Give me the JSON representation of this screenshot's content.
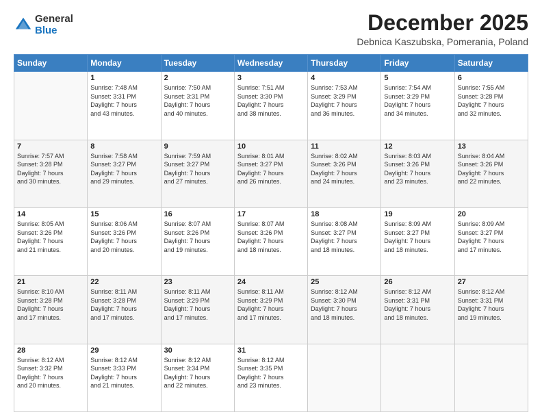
{
  "logo": {
    "general": "General",
    "blue": "Blue"
  },
  "header": {
    "month": "December 2025",
    "location": "Debnica Kaszubska, Pomerania, Poland"
  },
  "weekdays": [
    "Sunday",
    "Monday",
    "Tuesday",
    "Wednesday",
    "Thursday",
    "Friday",
    "Saturday"
  ],
  "weeks": [
    [
      {
        "day": "",
        "info": ""
      },
      {
        "day": "1",
        "info": "Sunrise: 7:48 AM\nSunset: 3:31 PM\nDaylight: 7 hours\nand 43 minutes."
      },
      {
        "day": "2",
        "info": "Sunrise: 7:50 AM\nSunset: 3:31 PM\nDaylight: 7 hours\nand 40 minutes."
      },
      {
        "day": "3",
        "info": "Sunrise: 7:51 AM\nSunset: 3:30 PM\nDaylight: 7 hours\nand 38 minutes."
      },
      {
        "day": "4",
        "info": "Sunrise: 7:53 AM\nSunset: 3:29 PM\nDaylight: 7 hours\nand 36 minutes."
      },
      {
        "day": "5",
        "info": "Sunrise: 7:54 AM\nSunset: 3:29 PM\nDaylight: 7 hours\nand 34 minutes."
      },
      {
        "day": "6",
        "info": "Sunrise: 7:55 AM\nSunset: 3:28 PM\nDaylight: 7 hours\nand 32 minutes."
      }
    ],
    [
      {
        "day": "7",
        "info": "Sunrise: 7:57 AM\nSunset: 3:28 PM\nDaylight: 7 hours\nand 30 minutes."
      },
      {
        "day": "8",
        "info": "Sunrise: 7:58 AM\nSunset: 3:27 PM\nDaylight: 7 hours\nand 29 minutes."
      },
      {
        "day": "9",
        "info": "Sunrise: 7:59 AM\nSunset: 3:27 PM\nDaylight: 7 hours\nand 27 minutes."
      },
      {
        "day": "10",
        "info": "Sunrise: 8:01 AM\nSunset: 3:27 PM\nDaylight: 7 hours\nand 26 minutes."
      },
      {
        "day": "11",
        "info": "Sunrise: 8:02 AM\nSunset: 3:26 PM\nDaylight: 7 hours\nand 24 minutes."
      },
      {
        "day": "12",
        "info": "Sunrise: 8:03 AM\nSunset: 3:26 PM\nDaylight: 7 hours\nand 23 minutes."
      },
      {
        "day": "13",
        "info": "Sunrise: 8:04 AM\nSunset: 3:26 PM\nDaylight: 7 hours\nand 22 minutes."
      }
    ],
    [
      {
        "day": "14",
        "info": "Sunrise: 8:05 AM\nSunset: 3:26 PM\nDaylight: 7 hours\nand 21 minutes."
      },
      {
        "day": "15",
        "info": "Sunrise: 8:06 AM\nSunset: 3:26 PM\nDaylight: 7 hours\nand 20 minutes."
      },
      {
        "day": "16",
        "info": "Sunrise: 8:07 AM\nSunset: 3:26 PM\nDaylight: 7 hours\nand 19 minutes."
      },
      {
        "day": "17",
        "info": "Sunrise: 8:07 AM\nSunset: 3:26 PM\nDaylight: 7 hours\nand 18 minutes."
      },
      {
        "day": "18",
        "info": "Sunrise: 8:08 AM\nSunset: 3:27 PM\nDaylight: 7 hours\nand 18 minutes."
      },
      {
        "day": "19",
        "info": "Sunrise: 8:09 AM\nSunset: 3:27 PM\nDaylight: 7 hours\nand 18 minutes."
      },
      {
        "day": "20",
        "info": "Sunrise: 8:09 AM\nSunset: 3:27 PM\nDaylight: 7 hours\nand 17 minutes."
      }
    ],
    [
      {
        "day": "21",
        "info": "Sunrise: 8:10 AM\nSunset: 3:28 PM\nDaylight: 7 hours\nand 17 minutes."
      },
      {
        "day": "22",
        "info": "Sunrise: 8:11 AM\nSunset: 3:28 PM\nDaylight: 7 hours\nand 17 minutes."
      },
      {
        "day": "23",
        "info": "Sunrise: 8:11 AM\nSunset: 3:29 PM\nDaylight: 7 hours\nand 17 minutes."
      },
      {
        "day": "24",
        "info": "Sunrise: 8:11 AM\nSunset: 3:29 PM\nDaylight: 7 hours\nand 17 minutes."
      },
      {
        "day": "25",
        "info": "Sunrise: 8:12 AM\nSunset: 3:30 PM\nDaylight: 7 hours\nand 18 minutes."
      },
      {
        "day": "26",
        "info": "Sunrise: 8:12 AM\nSunset: 3:31 PM\nDaylight: 7 hours\nand 18 minutes."
      },
      {
        "day": "27",
        "info": "Sunrise: 8:12 AM\nSunset: 3:31 PM\nDaylight: 7 hours\nand 19 minutes."
      }
    ],
    [
      {
        "day": "28",
        "info": "Sunrise: 8:12 AM\nSunset: 3:32 PM\nDaylight: 7 hours\nand 20 minutes."
      },
      {
        "day": "29",
        "info": "Sunrise: 8:12 AM\nSunset: 3:33 PM\nDaylight: 7 hours\nand 21 minutes."
      },
      {
        "day": "30",
        "info": "Sunrise: 8:12 AM\nSunset: 3:34 PM\nDaylight: 7 hours\nand 22 minutes."
      },
      {
        "day": "31",
        "info": "Sunrise: 8:12 AM\nSunset: 3:35 PM\nDaylight: 7 hours\nand 23 minutes."
      },
      {
        "day": "",
        "info": ""
      },
      {
        "day": "",
        "info": ""
      },
      {
        "day": "",
        "info": ""
      }
    ]
  ]
}
